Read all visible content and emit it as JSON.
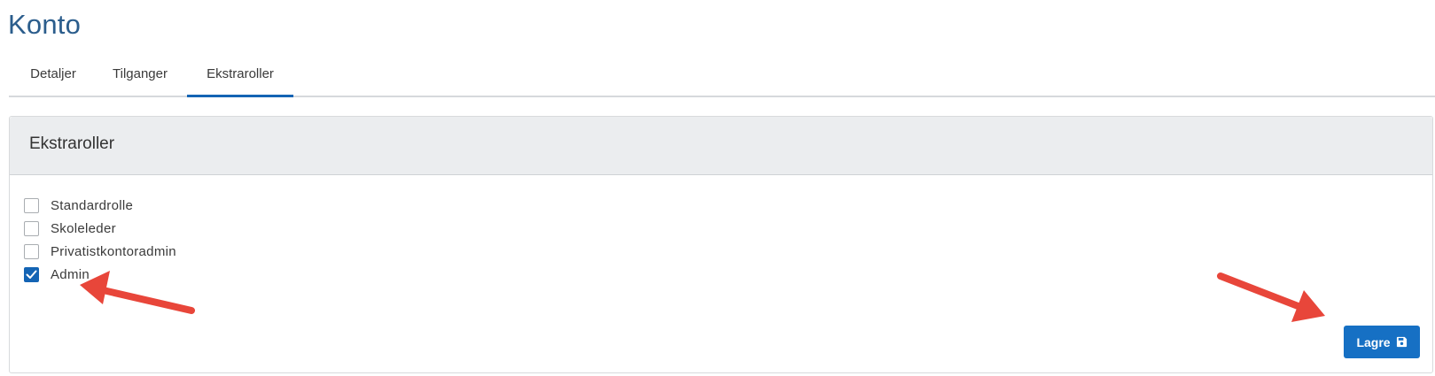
{
  "page": {
    "title": "Konto"
  },
  "tabs": [
    {
      "label": "Detaljer",
      "active": false
    },
    {
      "label": "Tilganger",
      "active": false
    },
    {
      "label": "Ekstraroller",
      "active": true
    }
  ],
  "panel": {
    "title": "Ekstraroller",
    "roles": [
      {
        "label": "Standardrolle",
        "checked": false
      },
      {
        "label": "Skoleleder",
        "checked": false
      },
      {
        "label": "Privatistkontoradmin",
        "checked": false
      },
      {
        "label": "Admin",
        "checked": true
      }
    ],
    "save_label": "Lagre",
    "save_icon": "floppy-disk-icon"
  },
  "colors": {
    "accent": "#1464b4",
    "title": "#2b5d8c",
    "annotation_arrow": "#e8463a"
  }
}
